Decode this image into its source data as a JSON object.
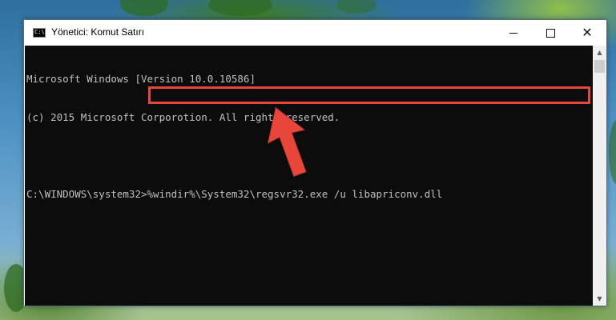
{
  "window": {
    "title": "Yönetici: Komut Satırı",
    "icon_text": "C:\\"
  },
  "controls": {
    "minimize_icon": "minimize-icon",
    "maximize_icon": "maximize-icon",
    "close_icon": "close-icon",
    "close_glyph": "✕"
  },
  "console": {
    "lines": [
      "Microsoft Windows [Version 10.0.10586]",
      "(c) 2015 Microsoft Corporotion. All rights reserved.",
      ""
    ],
    "prompt": "C:\\WINDOWS\\system32>",
    "command": "%windir%\\System32\\regsvr32.exe /u libapriconv.dll"
  },
  "scrollbar": {
    "up_glyph": "▲",
    "down_glyph": "▼"
  },
  "annotation": {
    "highlight_color": "#e8463a",
    "arrow_color": "#e8463a"
  }
}
